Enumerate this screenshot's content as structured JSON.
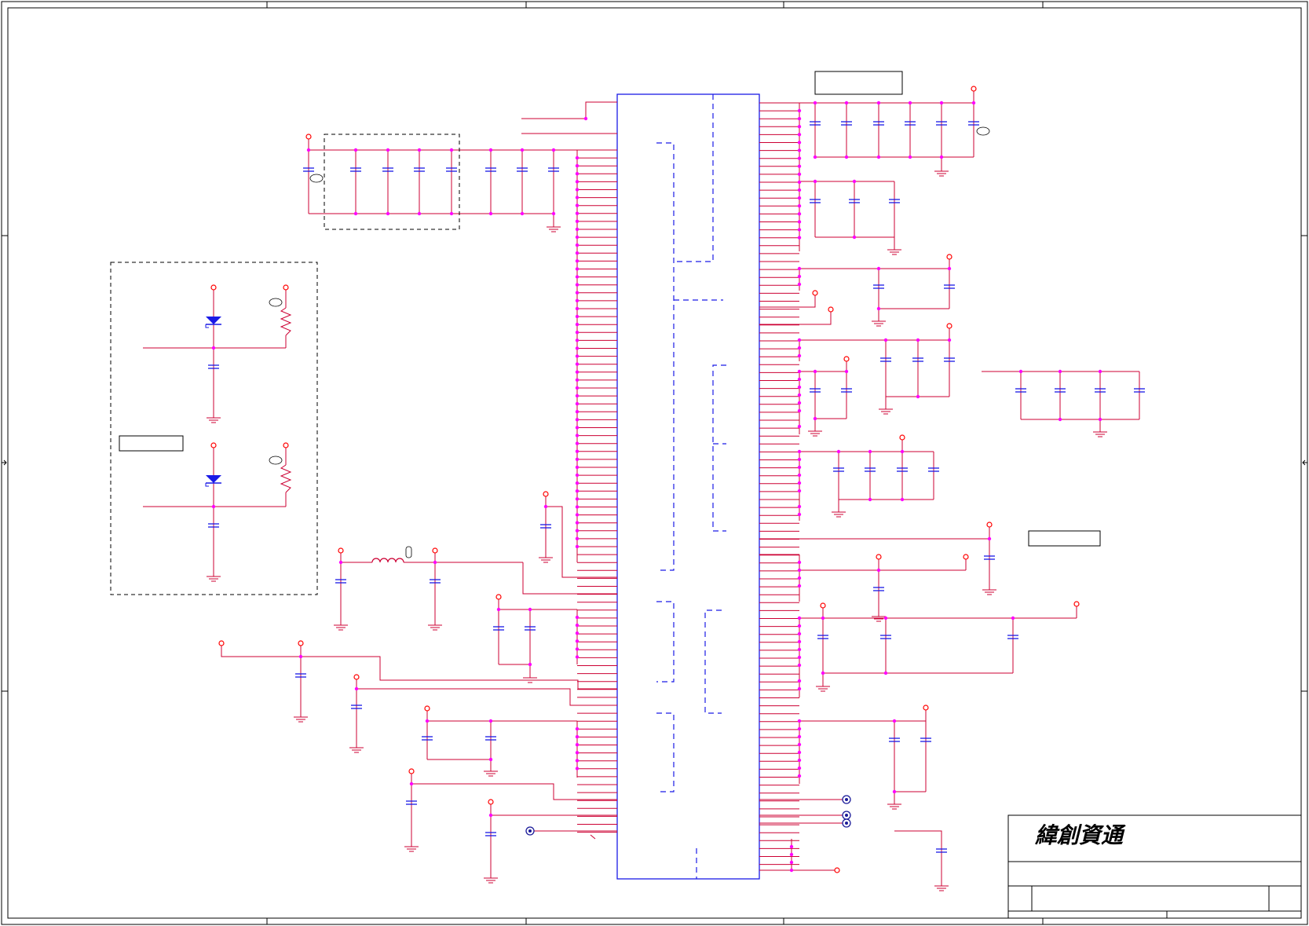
{
  "title_block": {
    "company_name": "緯創資通"
  },
  "colors": {
    "wire": "#cc0033",
    "part": "#1a1ae6",
    "junction": "#ff00ff",
    "power": "#ff0000",
    "border": "#000000",
    "offsheet": "#1a1a99"
  },
  "icons": {
    "gnd": "ground-symbol-icon",
    "vcc": "power-port-icon",
    "cap": "capacitor-icon",
    "diode": "diode-icon",
    "res": "resistor-icon",
    "ind": "inductor-icon",
    "conn": "offsheet-connector-icon"
  }
}
